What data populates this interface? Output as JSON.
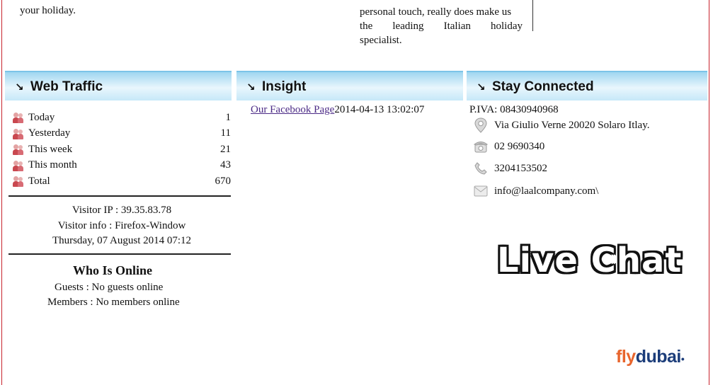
{
  "top": {
    "left_text": "your holiday.",
    "right_text_line1": "personal touch, really does make us",
    "right_text_line2_words": [
      "the",
      "leading",
      "Italian",
      "holiday"
    ],
    "right_text_line3": "specialist."
  },
  "panels": {
    "web_traffic": "Web Traffic",
    "insight": "Insight",
    "stay_connected": "Stay Connected"
  },
  "traffic": [
    {
      "label": "Today",
      "value": "1"
    },
    {
      "label": "Yesterday",
      "value": "11"
    },
    {
      "label": "This week",
      "value": "21"
    },
    {
      "label": "This month",
      "value": "43"
    },
    {
      "label": "Total",
      "value": "670"
    }
  ],
  "visitor": {
    "ip": "Visitor IP : 39.35.83.78",
    "info": "Visitor info : Firefox-Window",
    "datetime": "Thursday, 07 August 2014 07:12"
  },
  "who": {
    "title": "Who Is Online",
    "guests": "Guests : No guests online",
    "members": "Members : No members online"
  },
  "insight": {
    "link": "Our Facebook Page",
    "timestamp": "2014-04-13 13:02:07"
  },
  "contact": {
    "piva": "P.IVA: 08430940968",
    "address": "Via Giulio Verne 20020 Solaro Itlay.",
    "phone": "02 9690340",
    "mobile": "3204153502",
    "email": "info@laalcompany.com\\"
  },
  "live_chat": "Live Chat",
  "ad": {
    "fly": "fly",
    "dubai": "dubai"
  },
  "colors": {
    "frame": "#c8232c",
    "header_gradient": "#9fd6f0",
    "link": "#4b2a86"
  },
  "icons": [
    "arrow-down-right-icon",
    "visitors-icon",
    "location-pin-icon",
    "phone-icon",
    "mobile-icon",
    "mail-icon"
  ]
}
